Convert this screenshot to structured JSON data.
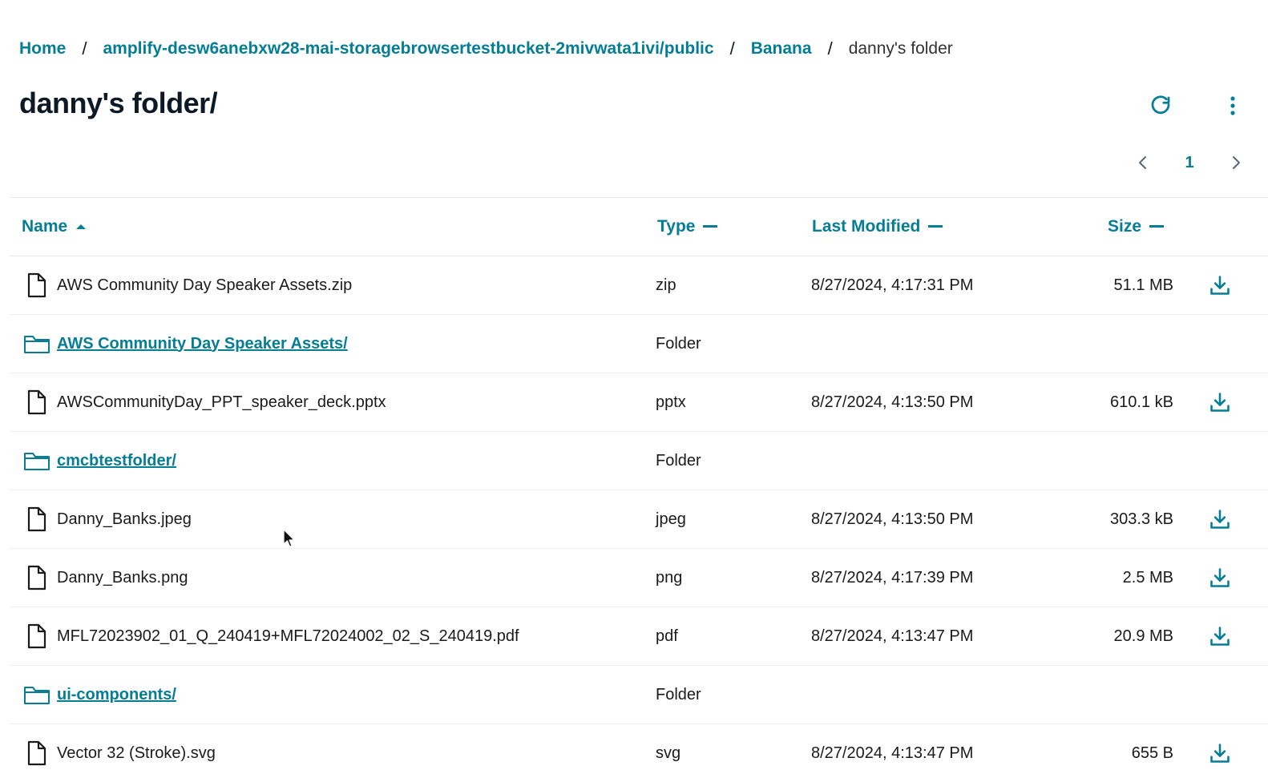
{
  "breadcrumb": {
    "items": [
      {
        "label": "Home"
      },
      {
        "label": "amplify-desw6anebxw28-mai-storagebrowsertestbucket-2mivwata1ivi/public"
      },
      {
        "label": "Banana"
      }
    ],
    "current": "danny's folder",
    "separator": "/"
  },
  "header": {
    "title": "danny's folder/"
  },
  "pagination": {
    "current_page": "1"
  },
  "table": {
    "columns": {
      "name": "Name",
      "type": "Type",
      "last_modified": "Last Modified",
      "size": "Size"
    },
    "rows": [
      {
        "kind": "file",
        "name": "AWS Community Day Speaker Assets.zip",
        "type": "zip",
        "modified": "8/27/2024, 4:17:31 PM",
        "size": "51.1 MB"
      },
      {
        "kind": "folder",
        "name": "AWS Community Day Speaker Assets/",
        "type": "Folder",
        "modified": "",
        "size": ""
      },
      {
        "kind": "file",
        "name": "AWSCommunityDay_PPT_speaker_deck.pptx",
        "type": "pptx",
        "modified": "8/27/2024, 4:13:50 PM",
        "size": "610.1 kB"
      },
      {
        "kind": "folder",
        "name": "cmcbtestfolder/",
        "type": "Folder",
        "modified": "",
        "size": ""
      },
      {
        "kind": "file",
        "name": "Danny_Banks.jpeg",
        "type": "jpeg",
        "modified": "8/27/2024, 4:13:50 PM",
        "size": "303.3 kB"
      },
      {
        "kind": "file",
        "name": "Danny_Banks.png",
        "type": "png",
        "modified": "8/27/2024, 4:17:39 PM",
        "size": "2.5 MB"
      },
      {
        "kind": "file",
        "name": "MFL72023902_01_Q_240419+MFL72024002_02_S_240419.pdf",
        "type": "pdf",
        "modified": "8/27/2024, 4:13:47 PM",
        "size": "20.9 MB"
      },
      {
        "kind": "folder",
        "name": "ui-components/",
        "type": "Folder",
        "modified": "",
        "size": ""
      },
      {
        "kind": "file",
        "name": "Vector 32 (Stroke).svg",
        "type": "svg",
        "modified": "8/27/2024, 4:13:47 PM",
        "size": "655 B"
      }
    ]
  },
  "colors": {
    "accent": "#047d95",
    "text": "#0d1a26",
    "border": "#e6e9ec"
  },
  "icons": {
    "file": "file-icon",
    "folder": "folder-icon",
    "download": "download-icon",
    "refresh": "refresh-icon",
    "more": "more-vertical-icon"
  }
}
